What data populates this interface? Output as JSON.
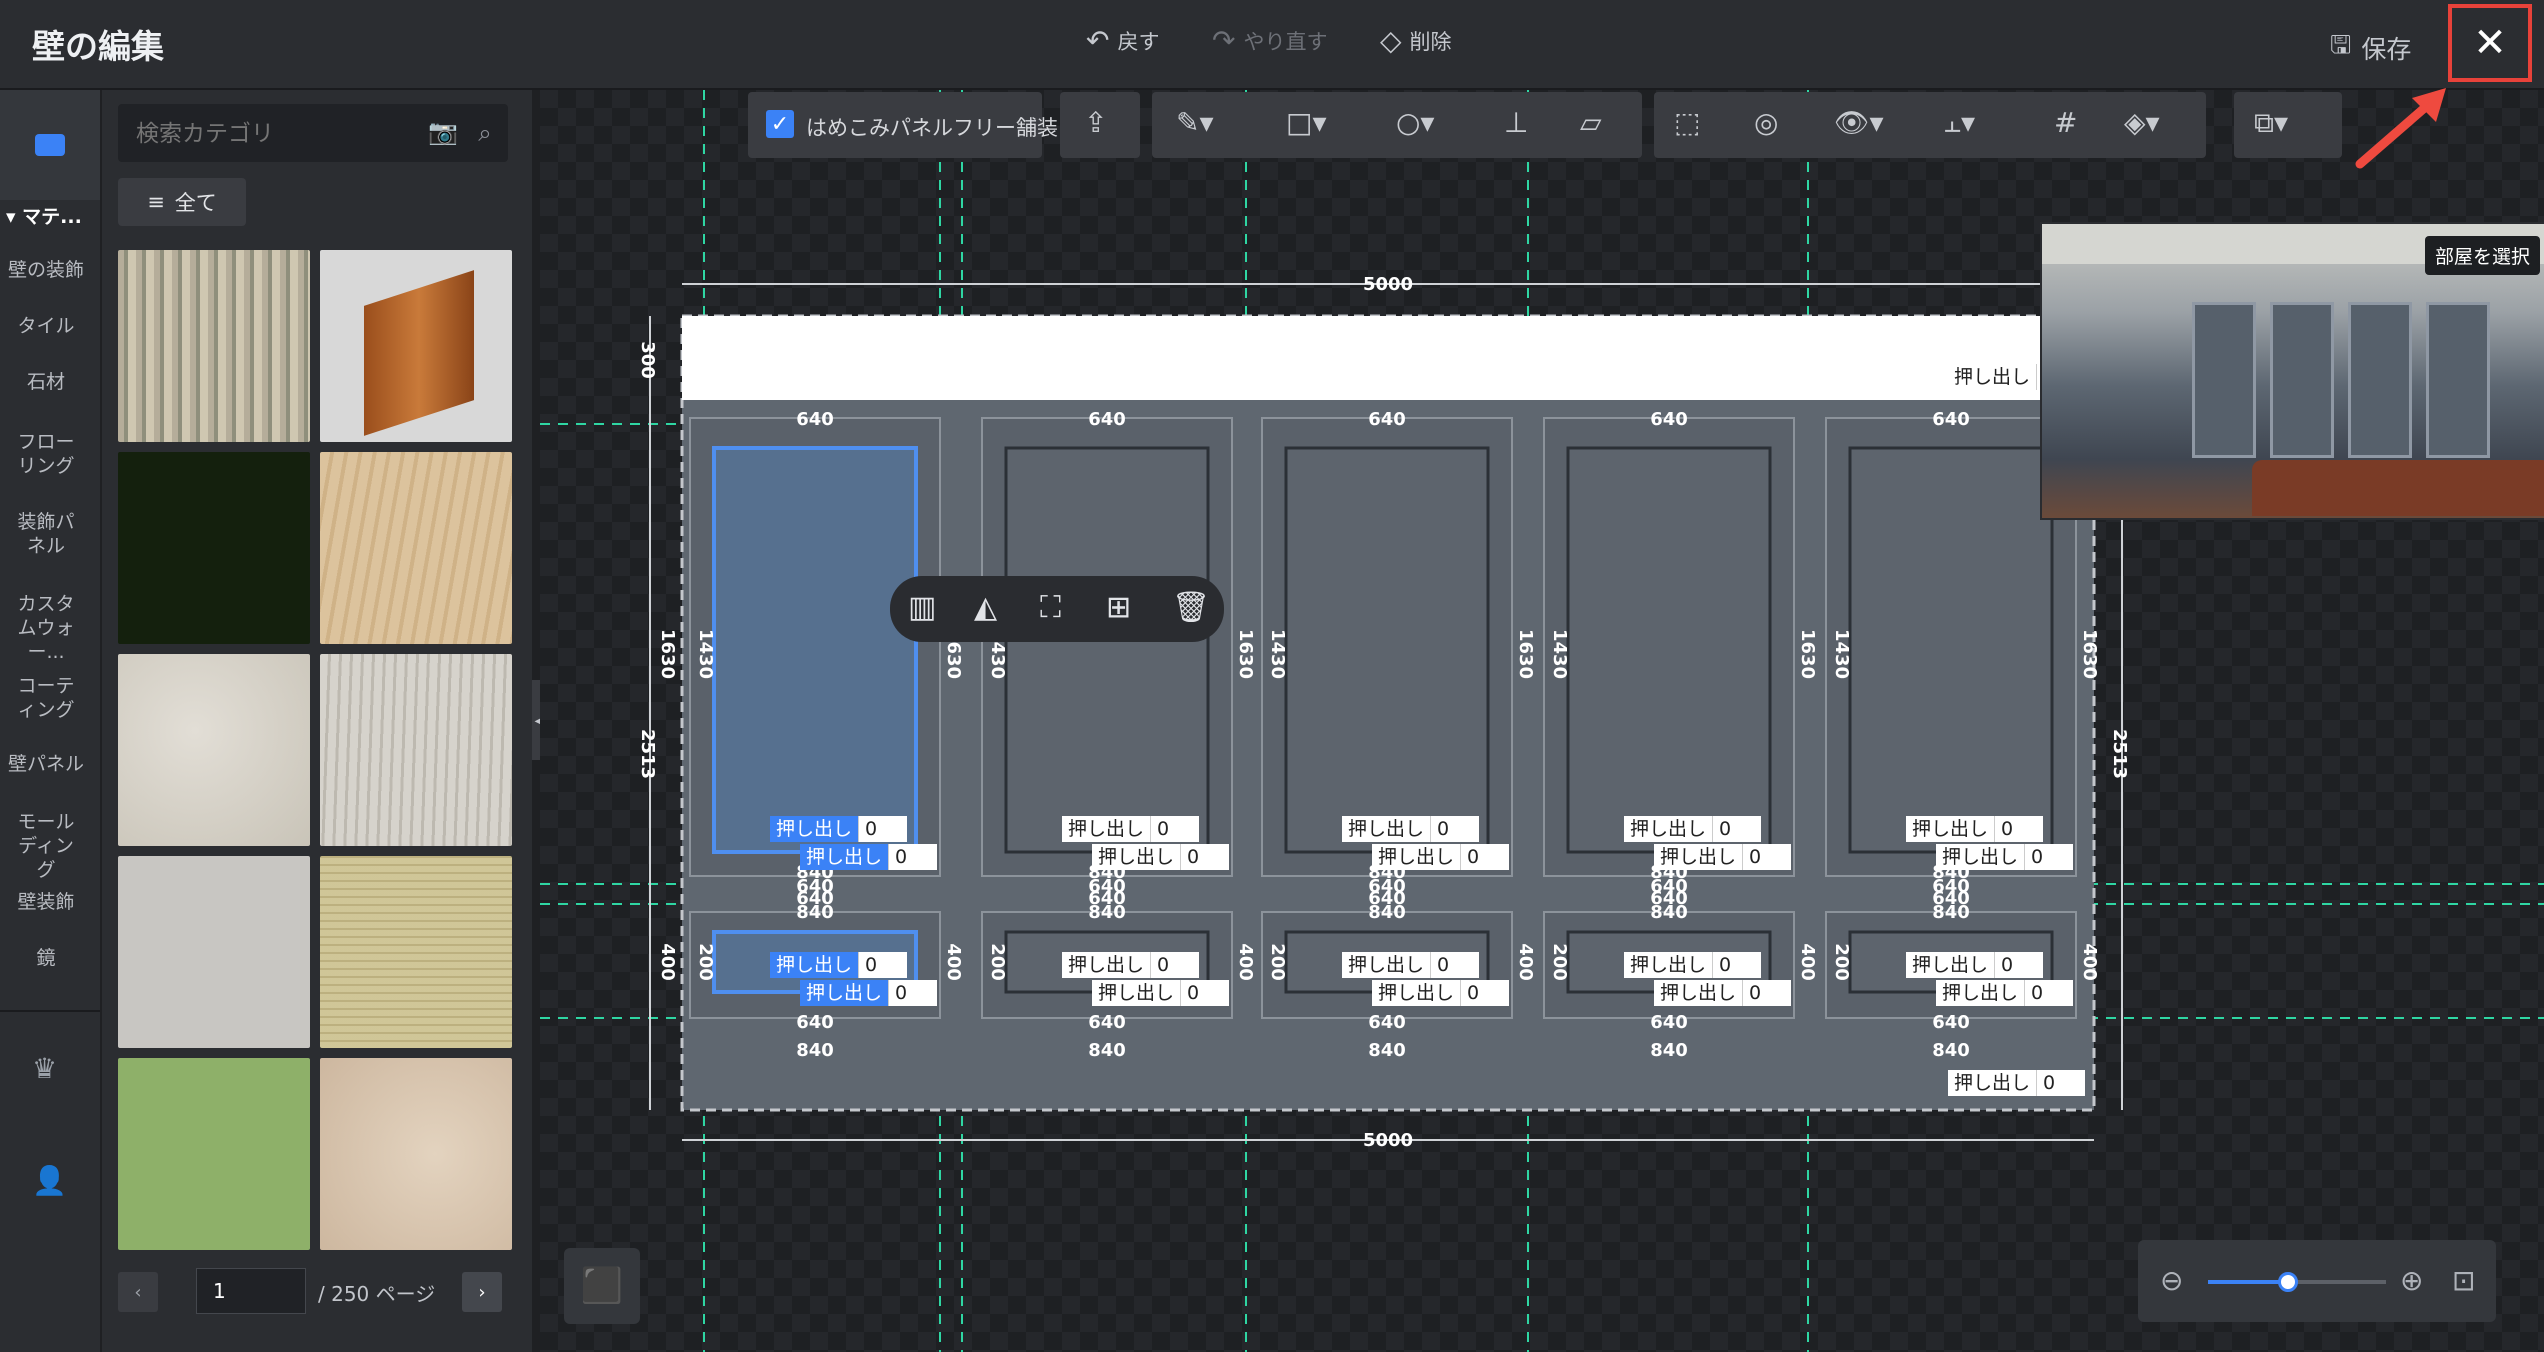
{
  "header": {
    "title": "壁の編集",
    "undo": "戻す",
    "redo": "やり直す",
    "delete": "削除",
    "save": "保存"
  },
  "rail": {
    "section": "マテ...",
    "categories": [
      "壁の装飾",
      "タイル",
      "石材",
      "フローリング",
      "装飾パネル",
      "カスタムウォー...",
      "コーティング",
      "壁パネル",
      "モールディング",
      "壁装飾",
      "鏡"
    ]
  },
  "library": {
    "search_placeholder": "検索カテゴリ",
    "all_label": "全て",
    "page_value": "1",
    "page_total": "/ 250 ページ",
    "tiles": [
      "#b8b4a4",
      "#c9c9c9",
      "#16220f",
      "#d9c09a",
      "#d4d0c8",
      "#cac6bf",
      "#c7c5c1",
      "#e1dcbe",
      "#8fb06a",
      "#d8c8b4"
    ]
  },
  "toolbar": {
    "panel_free_label": "はめこみパネルフリー舗装"
  },
  "preview": {
    "room_select": "部屋を選択"
  },
  "wall": {
    "width_total": "5000",
    "inner_width": "5000",
    "top_band_h": "300",
    "total_h": "2513",
    "upper_h": "1630",
    "upper_inner_h": "1430",
    "lower_h": "400",
    "lower_inner_h": "200",
    "module_w": "840",
    "panel_w": "640",
    "extrude_label": "押し出し",
    "extrude_value": "0"
  },
  "zoom": {
    "level": 0.45
  }
}
